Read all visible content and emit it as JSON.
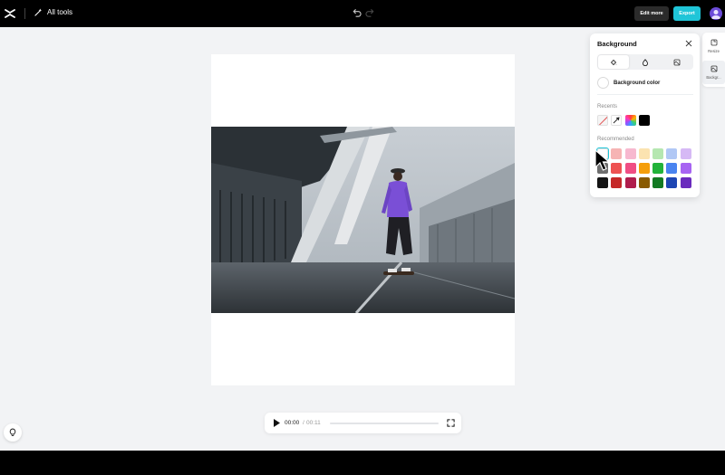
{
  "topbar": {
    "all_tools_label": "All tools",
    "edit_more_label": "Edit more",
    "export_label": "Export",
    "export_color": "#1fc5d8"
  },
  "player": {
    "current_time": "00:00",
    "separator": "/",
    "duration": "00:11",
    "progress": 0
  },
  "rail": {
    "items": [
      {
        "label": "Resize",
        "icon": "resize-icon"
      },
      {
        "label": "Backgr...",
        "icon": "background-icon"
      }
    ]
  },
  "panel": {
    "title": "Background",
    "tabs": [
      {
        "icon": "paint-bucket-icon",
        "active": true
      },
      {
        "icon": "blur-drop-icon",
        "active": false
      },
      {
        "icon": "image-icon",
        "active": false
      }
    ],
    "background_color_label": "Background color",
    "recents_label": "Recents",
    "recommended_label": "Recommended",
    "recent_colors": [
      "none",
      "picker",
      "gradient",
      "#000000"
    ],
    "recommended_colors": [
      "#ffffff",
      "#f6b4b4",
      "#f7b8cf",
      "#fbe3b0",
      "#b5e7b1",
      "#b1c8f5",
      "#d6b9f5",
      "#6e6e6e",
      "#ee5252",
      "#f04e84",
      "#f59e0b",
      "#22b33a",
      "#4a84f0",
      "#a764f2",
      "#141414",
      "#c52828",
      "#b01d4c",
      "#8a5a00",
      "#137a23",
      "#1e46b3",
      "#6a2bbd"
    ]
  }
}
